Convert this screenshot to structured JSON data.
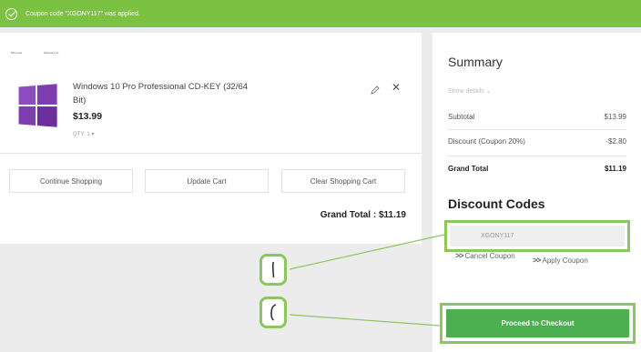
{
  "notice": {
    "message": "Coupon code \"XGONY117\" was applied."
  },
  "product": {
    "thumb_label_left": "Microsoft",
    "thumb_label_right": "Windows 10",
    "name": "Windows 10 Pro Professional CD-KEY (32/64 Bit)",
    "price": "$13.99",
    "qty": "QTY: 1 ▾"
  },
  "actions": {
    "continue": "Continue Shopping",
    "update": "Update Cart",
    "clear": "Clear Shopping Cart"
  },
  "grand_total": "Grand Total : $11.19",
  "summary": {
    "title": "Summary",
    "show_details": "Show details ⌄",
    "subtotal_label": "Subtotal",
    "subtotal_value": "$13.99",
    "discount_label": "Discount (Coupon 20%)",
    "discount_value": "-$2.80",
    "grand_label": "Grand Total",
    "grand_value": "$11.19"
  },
  "discount": {
    "title": "Discount Codes",
    "code": "XGONY117",
    "cancel_label": "Cancel Coupon",
    "apply_label": "Apply Coupon"
  },
  "checkout": {
    "label": "Proceed to Checkout"
  },
  "colors": {
    "accent_green": "#7cc242",
    "button_green": "#4caf50",
    "highlight": "#8dc660",
    "logo_purple": "#7d3fb0"
  }
}
